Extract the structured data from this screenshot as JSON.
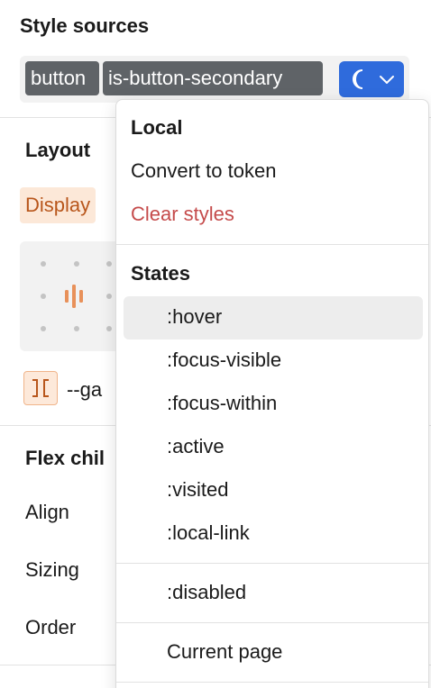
{
  "style_sources": {
    "title": "Style sources",
    "tokens": [
      "button",
      "is-button-secondary"
    ]
  },
  "panel": {
    "layout": {
      "title": "Layout",
      "display_label": "Display",
      "gap_value": "--ga"
    },
    "flex_child": {
      "title": "Flex chil",
      "rows": [
        "Align",
        "Sizing",
        "Order"
      ]
    }
  },
  "menu": {
    "local_header": "Local",
    "convert_to_token": "Convert to token",
    "clear_styles": "Clear styles",
    "states_header": "States",
    "states": [
      ":hover",
      ":focus-visible",
      ":focus-within",
      ":active",
      ":visited",
      ":local-link"
    ],
    "disabled": ":disabled",
    "current_page": "Current page"
  },
  "colors": {
    "token_bg": "#5f6367",
    "accent": "#2f6bdc",
    "danger": "#c54b4b",
    "display_bg": "#fce8d8",
    "display_text": "#b8561b"
  },
  "icons": {
    "state_button_icon": "moon-icon",
    "state_button_chevron": "chevron-down-icon",
    "flex_preview": "flex-alignment-icon",
    "gap": "gap-icon"
  }
}
